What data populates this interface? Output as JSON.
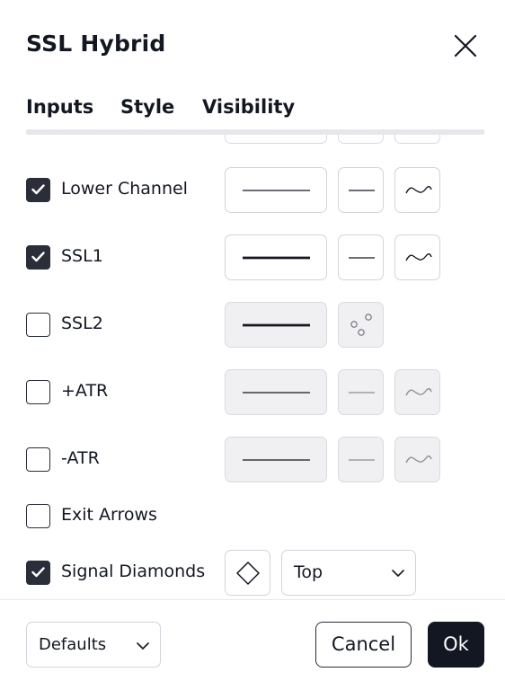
{
  "dialog": {
    "title": "SSL Hybrid"
  },
  "tabs": [
    {
      "label": "Inputs"
    },
    {
      "label": "Style",
      "active": true
    },
    {
      "label": "Visibility"
    }
  ],
  "rows": [
    {
      "label": "Lower Channel",
      "checked": true,
      "line_style": "thin",
      "enabled": true
    },
    {
      "label": "SSL1",
      "checked": true,
      "line_style": "thick",
      "enabled": true
    },
    {
      "label": "SSL2",
      "checked": false,
      "line_style": "thick",
      "enabled": false,
      "plot_type": "circles-icon"
    },
    {
      "label": "+ATR",
      "checked": false,
      "line_style": "thin",
      "enabled": false
    },
    {
      "label": "-ATR",
      "checked": false,
      "line_style": "thin",
      "enabled": false
    },
    {
      "label": "Exit Arrows",
      "checked": false
    },
    {
      "label": "Signal Diamonds",
      "checked": true,
      "shape": "diamond-icon",
      "location": "Top"
    }
  ],
  "footer": {
    "defaults_label": "Defaults",
    "cancel_label": "Cancel",
    "ok_label": "Ok"
  },
  "colors": {
    "checkbox_on": "#2a2e39",
    "ok_button": "#131722",
    "disabled_fill": "#f0f0f2"
  }
}
